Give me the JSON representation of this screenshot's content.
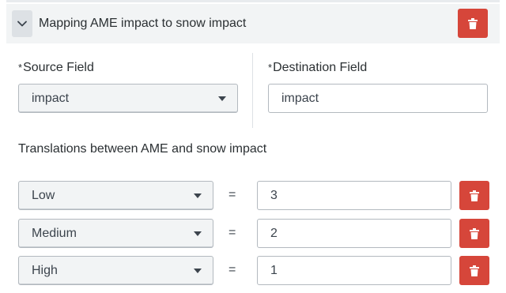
{
  "header": {
    "title": "Mapping AME impact to snow impact",
    "collapse_icon": "chevron-down-icon",
    "delete_icon": "trash-icon",
    "delete_color": "#d6463a"
  },
  "source_field": {
    "required_marker": "*",
    "label": "Source Field",
    "selected": "impact"
  },
  "destination_field": {
    "required_marker": "*",
    "label": "Destination Field",
    "value": "impact"
  },
  "translations": {
    "title": "Translations between AME and snow impact",
    "equals": "=",
    "rows": [
      {
        "source": "Low",
        "target": "3"
      },
      {
        "source": "Medium",
        "target": "2"
      },
      {
        "source": "High",
        "target": "1"
      }
    ]
  }
}
